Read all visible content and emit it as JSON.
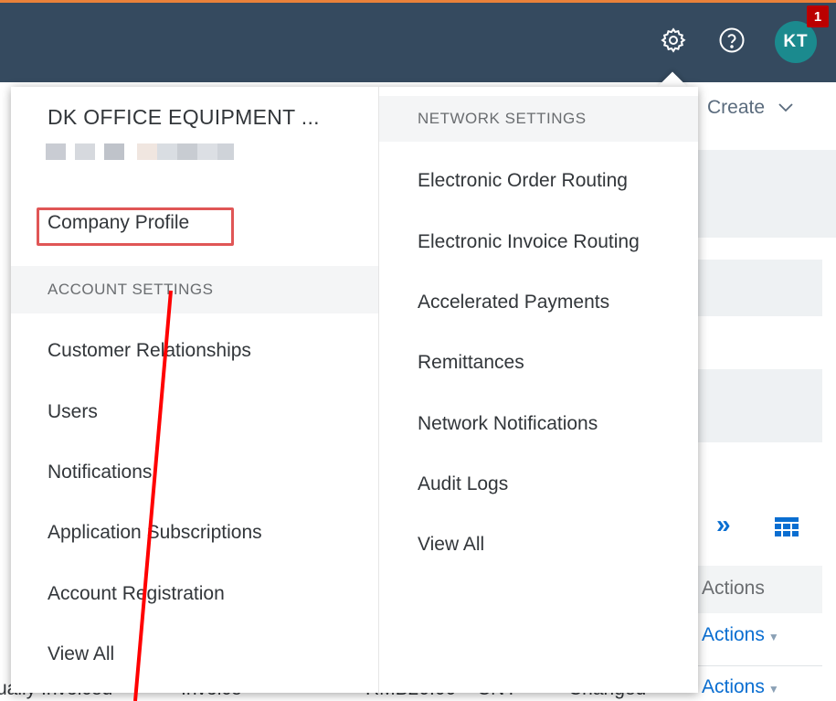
{
  "shell": {
    "avatar_initials": "KT",
    "notification_count": "1"
  },
  "background": {
    "create_label": "Create",
    "table_header": "Actions",
    "row_action_1": "Actions",
    "row_action_2": "Actions",
    "cut_text_1": "ually Invoiced",
    "cut_text_2": "Invoice",
    "cut_text_3": "RMB20.00",
    "cut_text_4": "CNY",
    "cut_text_5": "Changed"
  },
  "popover": {
    "company_name": "DK OFFICE EQUIPMENT ...",
    "company_profile": "Company Profile",
    "account_settings": {
      "header": "ACCOUNT SETTINGS",
      "items": [
        {
          "label": "Customer Relationships"
        },
        {
          "label": "Users"
        },
        {
          "label": "Notifications"
        },
        {
          "label": "Application Subscriptions"
        },
        {
          "label": "Account Registration"
        },
        {
          "label": "View All"
        }
      ]
    },
    "network_settings": {
      "header": "NETWORK SETTINGS",
      "items": [
        {
          "label": "Electronic Order Routing"
        },
        {
          "label": "Electronic Invoice Routing"
        },
        {
          "label": "Accelerated Payments"
        },
        {
          "label": "Remittances"
        },
        {
          "label": "Network Notifications"
        },
        {
          "label": "Audit Logs"
        },
        {
          "label": "View All"
        }
      ]
    }
  },
  "colors": {
    "shell_bg": "#354a5f",
    "accent_orange": "#e9813a",
    "avatar": "#1b8a8e",
    "badge": "#bb0000",
    "link_blue": "#0a6ed1",
    "annotation_red": "#ff0000"
  }
}
